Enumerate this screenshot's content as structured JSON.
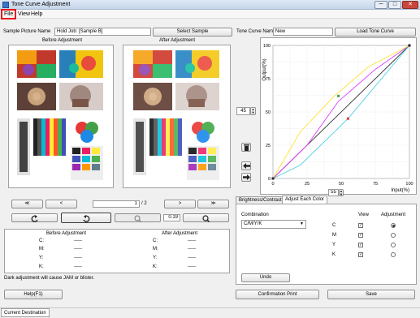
{
  "window": {
    "title": "Tone Curve Adjustment",
    "controls": {
      "minimize": "─",
      "maximize": "□",
      "close": "✕"
    }
  },
  "menu": [
    {
      "label": "File"
    },
    {
      "label": "View"
    },
    {
      "label": "Help"
    }
  ],
  "sample": {
    "label": "Sample Picture Name",
    "value": "Hold Job: [Sample B]",
    "select_button": "Select Sample"
  },
  "tone_curve": {
    "label": "Tone Curve Name",
    "value": "New",
    "load_button": "Load Tone Curve"
  },
  "previews": {
    "before_label": "Before Adjustment",
    "after_label": "After Adjustment"
  },
  "navigation": {
    "first": "≪",
    "prev": "<",
    "next": ">",
    "last": "≫",
    "page_current": "1",
    "page_total": "/ 2",
    "zoom_value": "0.19"
  },
  "graph": {
    "y_axis_label": "Output(%)",
    "x_axis_label": "Input(%)",
    "y_ticks": [
      "100",
      "75",
      "50",
      "25",
      "0"
    ],
    "x_ticks": [
      "0",
      "25",
      "50",
      "75",
      "100"
    ],
    "spin_input_value": "45",
    "spin_x_value": "55",
    "curve_colors": {
      "c": "#4dd0e1",
      "m": "#e040fb",
      "y": "#ffe135",
      "k": "#333333"
    }
  },
  "info": {
    "before_header": "Before Adjustment",
    "after_header": "After Adjustment",
    "rows": [
      {
        "label": "C:",
        "before": "-----",
        "after_label": "C:",
        "after": "-----"
      },
      {
        "label": "M:",
        "before": "-----",
        "after_label": "M:",
        "after": "-----"
      },
      {
        "label": "Y:",
        "before": "-----",
        "after_label": "Y:",
        "after": "-----"
      },
      {
        "label": "K:",
        "before": "-----",
        "after_label": "K:",
        "after": "-----"
      }
    ],
    "warning": "Dark adjustment will cause JAM or blister."
  },
  "tabs": [
    {
      "label": "Brightness/Contrast"
    },
    {
      "label": "Adjust Each Color"
    }
  ],
  "adjust": {
    "combination_label": "Combination",
    "combination_value": "C/M/Y/K",
    "view_header": "View",
    "adjustment_header": "Adjustment",
    "colors": [
      {
        "label": "C",
        "view": true,
        "selected": true
      },
      {
        "label": "M",
        "view": true,
        "selected": false
      },
      {
        "label": "Y",
        "view": true,
        "selected": false
      },
      {
        "label": "K",
        "view": true,
        "selected": false
      }
    ],
    "undo_button": "Undo"
  },
  "footer": {
    "help_button": "Help(F1)",
    "confirm_button": "Confirmation Print",
    "save_button": "Save"
  },
  "status": {
    "tab": "Current Destination"
  }
}
